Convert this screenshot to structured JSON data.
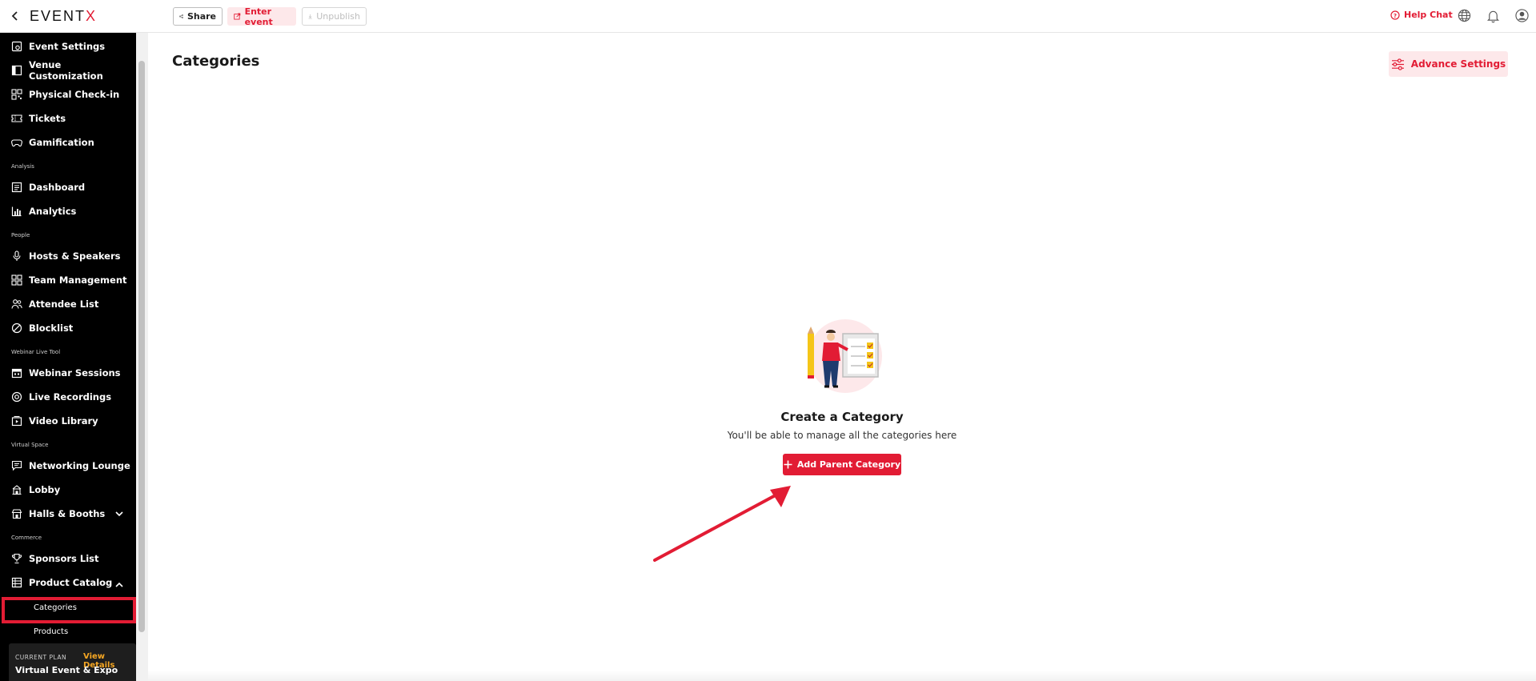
{
  "topbar": {
    "logo_main": "EVENT",
    "logo_x": "X",
    "share_label": "Share",
    "enter_event_label": "Enter event",
    "unpublish_label": "Unpublish",
    "help_chat_label": "Help Chat",
    "accent_color": "#e21c34"
  },
  "sidebar": {
    "items": [
      {
        "label": "Event Settings",
        "icon": "settings-icon"
      },
      {
        "label": "Venue Customization",
        "icon": "layout-icon"
      },
      {
        "label": "Physical Check-in",
        "icon": "qr-icon"
      },
      {
        "label": "Tickets",
        "icon": "ticket-icon"
      },
      {
        "label": "Gamification",
        "icon": "gamepad-icon"
      },
      {
        "label": "Dashboard",
        "icon": "dashboard-icon"
      },
      {
        "label": "Analytics",
        "icon": "bar-chart-icon"
      },
      {
        "label": "Hosts & Speakers",
        "icon": "mic-icon"
      },
      {
        "label": "Team Management",
        "icon": "team-icon"
      },
      {
        "label": "Attendee List",
        "icon": "people-icon"
      },
      {
        "label": "Blocklist",
        "icon": "block-icon"
      },
      {
        "label": "Webinar Sessions",
        "icon": "calendar-icon"
      },
      {
        "label": "Live Recordings",
        "icon": "record-icon"
      },
      {
        "label": "Video Library",
        "icon": "video-library-icon"
      },
      {
        "label": "Networking Lounge",
        "icon": "chat-icon"
      },
      {
        "label": "Lobby",
        "icon": "lobby-icon"
      },
      {
        "label": "Halls & Booths",
        "icon": "booth-icon"
      },
      {
        "label": "Sponsors List",
        "icon": "trophy-icon"
      },
      {
        "label": "Product Catalog",
        "icon": "catalog-icon"
      }
    ],
    "sections": {
      "analysis": "Analysis",
      "people": "People",
      "webinar": "Webinar Live Tool",
      "virtual": "Virtual Space",
      "commerce": "Commerce"
    },
    "sub_items": {
      "categories": "Categories",
      "products": "Products"
    },
    "plan": {
      "label": "CURRENT PLAN",
      "link": "View Details",
      "name": "Virtual Event & Expo"
    }
  },
  "main": {
    "title": "Categories",
    "advance_settings_label": "Advance Settings",
    "empty_title": "Create a Category",
    "empty_subtitle": "You'll be able to manage all the categories here",
    "add_button_label": "Add Parent Category"
  }
}
